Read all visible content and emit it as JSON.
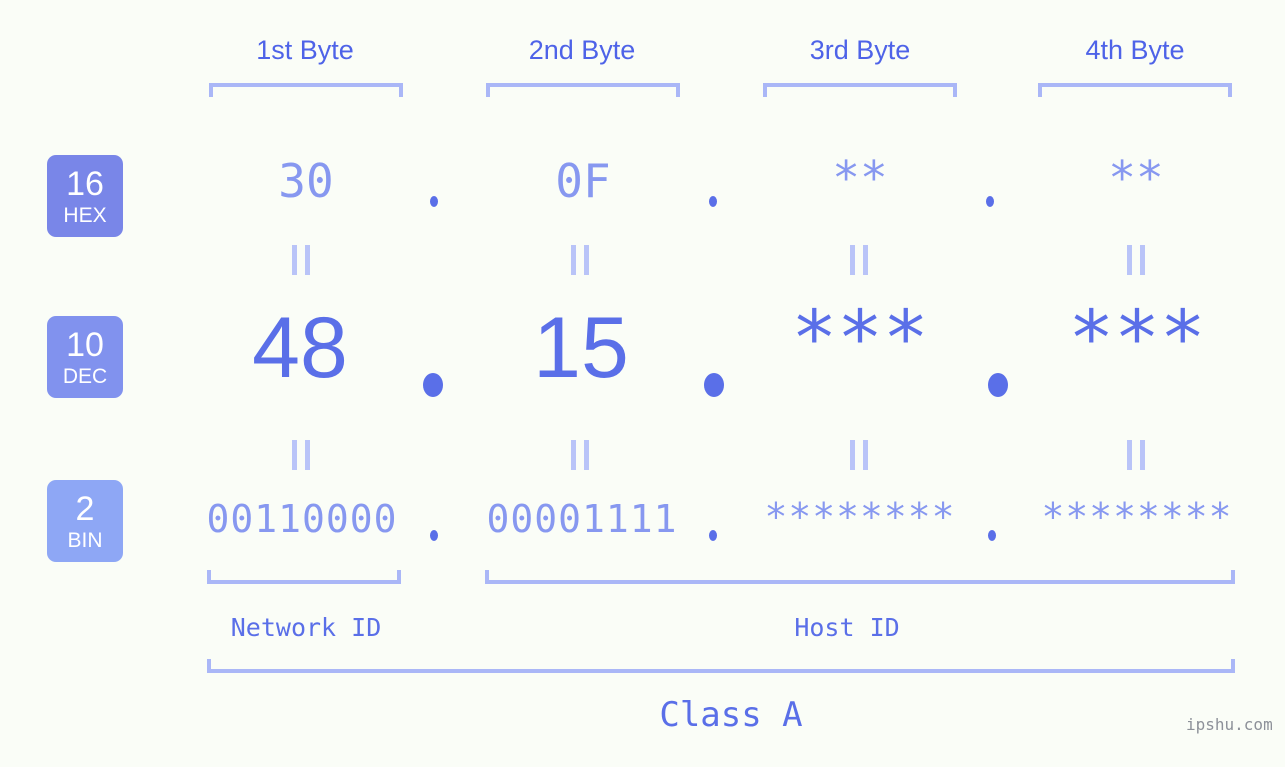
{
  "theme": {
    "background": "#fafdf7",
    "accent_strong": "#5a6fe8",
    "accent_mid": "#8798f0",
    "accent_light": "#aab7f7",
    "badge_hex": "#7986e8",
    "badge_dec": "#8192ee",
    "badge_bin": "#8ea7f5",
    "watermark": "#8d9199"
  },
  "byte_headers": [
    {
      "label": "1st Byte"
    },
    {
      "label": "2nd Byte"
    },
    {
      "label": "3rd Byte"
    },
    {
      "label": "4th Byte"
    }
  ],
  "rows": [
    {
      "base_number": "16",
      "base_name": "HEX",
      "values": [
        "30",
        "0F",
        "**",
        "**"
      ],
      "separator": "."
    },
    {
      "base_number": "10",
      "base_name": "DEC",
      "values": [
        "48",
        "15",
        "***",
        "***"
      ],
      "separator": "."
    },
    {
      "base_number": "2",
      "base_name": "BIN",
      "values": [
        "00110000",
        "00001111",
        "********",
        "********"
      ],
      "separator": "."
    }
  ],
  "equals_marks": {
    "symbol": "=",
    "count_per_row_gap": 4
  },
  "sections": [
    {
      "label": "Network ID"
    },
    {
      "label": "Host ID"
    }
  ],
  "class": {
    "label": "Class A"
  },
  "watermark": {
    "text": "ipshu.com"
  }
}
